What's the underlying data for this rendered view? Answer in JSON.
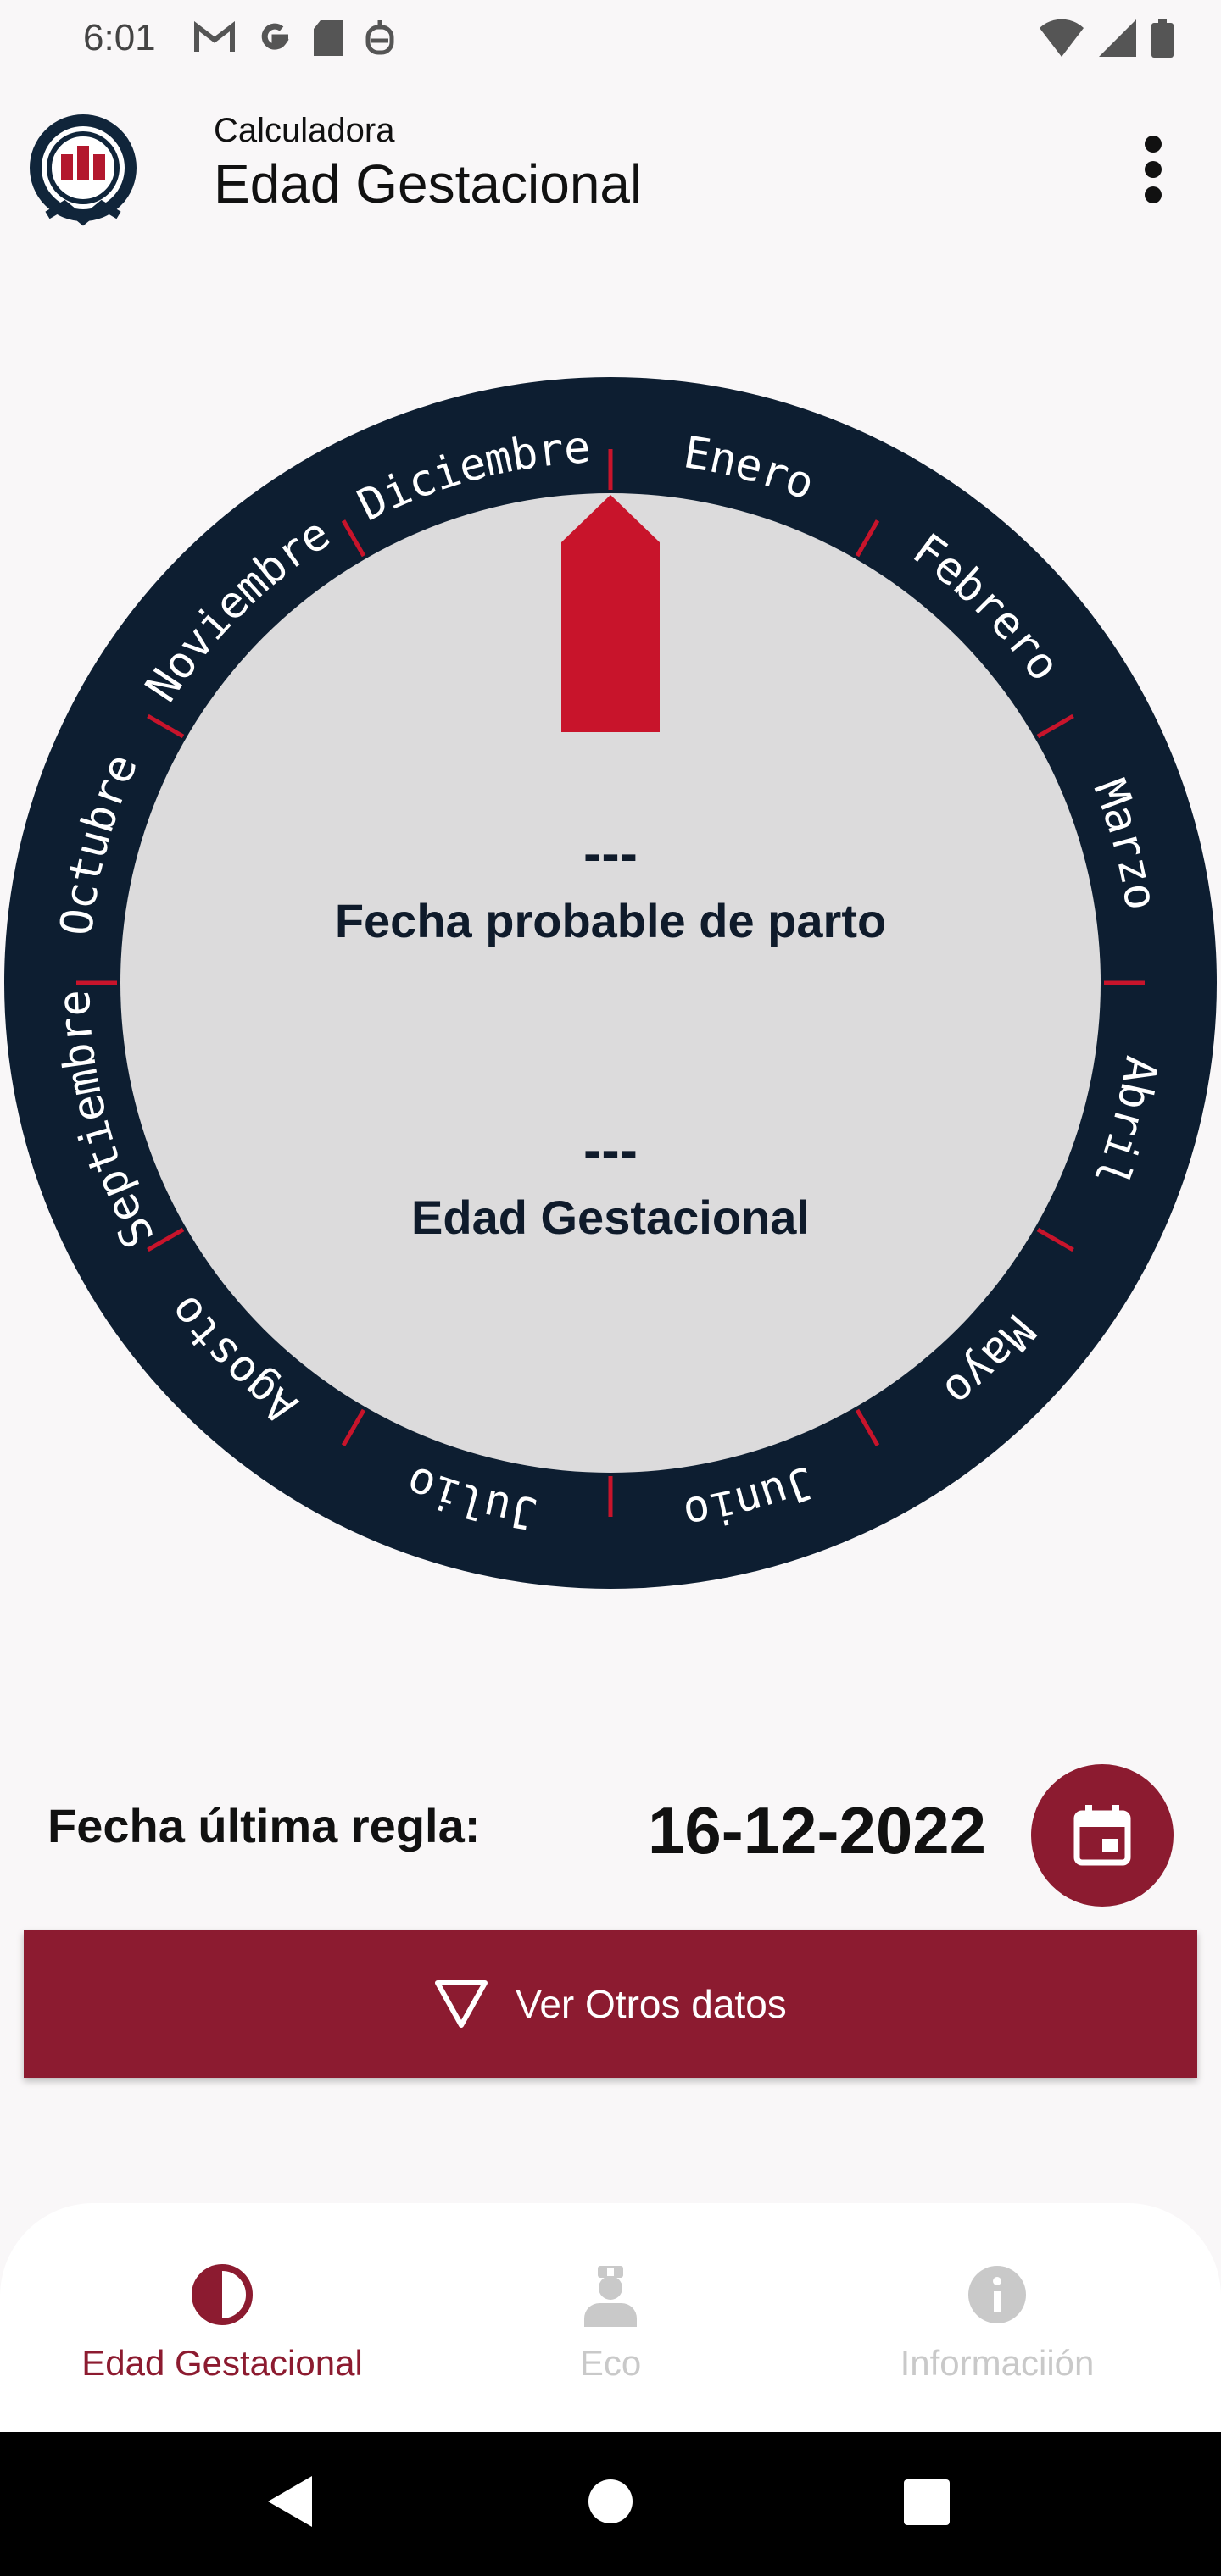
{
  "status": {
    "time": "6:01",
    "icons": [
      "gmail-icon",
      "google-icon",
      "sd-card-icon",
      "app-notification-icon"
    ],
    "right_icons": [
      "wifi-icon",
      "signal-icon",
      "battery-icon"
    ]
  },
  "app_bar": {
    "subtitle": "Calculadora",
    "title": "Edad Gestacional"
  },
  "wheel": {
    "months": [
      "Enero",
      "Febrero",
      "Marzo",
      "Abril",
      "Mayo",
      "Junio",
      "Julio",
      "Agosto",
      "Septiembre",
      "Octubre",
      "Noviembre",
      "Diciembre"
    ],
    "fpp_value": "---",
    "fpp_label": "Fecha probable de parto",
    "eg_value": "---",
    "eg_label": "Edad Gestacional",
    "ring_color": "#0d1e31",
    "inner_color": "#dcdbdc",
    "pointer_color": "#c8142b"
  },
  "form": {
    "fur_label": "Fecha última regla:",
    "fur_value": "16-12-2022",
    "ver_otros": "Ver Otros datos"
  },
  "bottom_nav": {
    "items": [
      {
        "label": "Edad Gestacional",
        "icon": "half-circle-icon",
        "active": true
      },
      {
        "label": "Eco",
        "icon": "doctor-icon",
        "active": false
      },
      {
        "label": "Informaciión",
        "icon": "info-icon",
        "active": false
      }
    ]
  },
  "colors": {
    "primary": "#8c1b30",
    "inactive": "#c9c9c9"
  }
}
